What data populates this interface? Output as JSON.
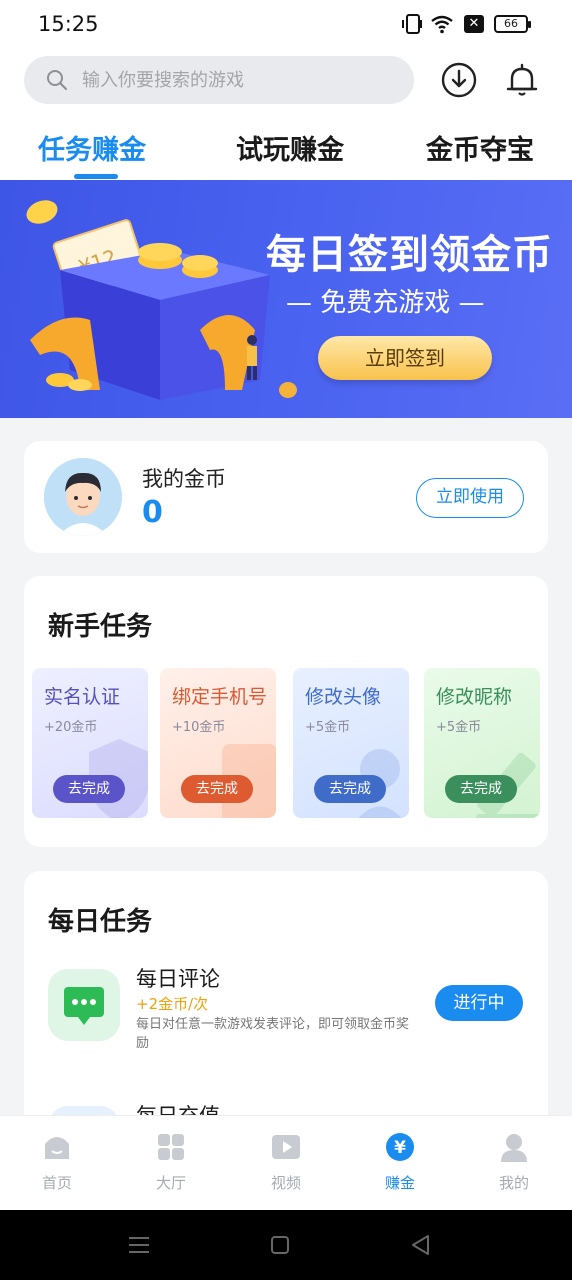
{
  "status_bar": {
    "time": "15:25",
    "battery": "66"
  },
  "search": {
    "placeholder": "输入你要搜索的游戏"
  },
  "tabs": [
    {
      "label": "任务赚金",
      "active": true
    },
    {
      "label": "试玩赚金",
      "active": false
    },
    {
      "label": "金币夺宝",
      "active": false
    }
  ],
  "banner": {
    "title": "每日签到领金币",
    "subtitle": "— 免费充游戏 —",
    "button": "立即签到",
    "ticket_text": "¥12"
  },
  "coins": {
    "label": "我的金币",
    "value": "0",
    "button": "立即使用"
  },
  "newbie": {
    "title": "新手任务",
    "tasks": [
      {
        "title": "实名认证",
        "reward": "+20金币",
        "button": "去完成",
        "color": "#5a54c8"
      },
      {
        "title": "绑定手机号",
        "reward": "+10金币",
        "button": "去完成",
        "color": "#de5a30"
      },
      {
        "title": "修改头像",
        "reward": "+5金币",
        "button": "去完成",
        "color": "#3f6cc9"
      },
      {
        "title": "修改昵称",
        "reward": "+5金币",
        "button": "去完成",
        "color": "#3a8f5c"
      }
    ]
  },
  "daily": {
    "title": "每日任务",
    "items": [
      {
        "name": "每日评论",
        "reward": "+2金币/次",
        "desc": "每日对任意一款游戏发表评论，即可领取金币奖励",
        "button": "进行中"
      },
      {
        "name": "每日充值"
      }
    ]
  },
  "bottom_nav": [
    {
      "label": "首页",
      "icon": "home-icon"
    },
    {
      "label": "大厅",
      "icon": "grid-icon"
    },
    {
      "label": "视频",
      "icon": "video-icon"
    },
    {
      "label": "赚金",
      "icon": "yen-icon",
      "active": true
    },
    {
      "label": "我的",
      "icon": "user-icon"
    }
  ],
  "colors": {
    "accent": "#1a8cf0",
    "reward": "#f0a20c"
  }
}
